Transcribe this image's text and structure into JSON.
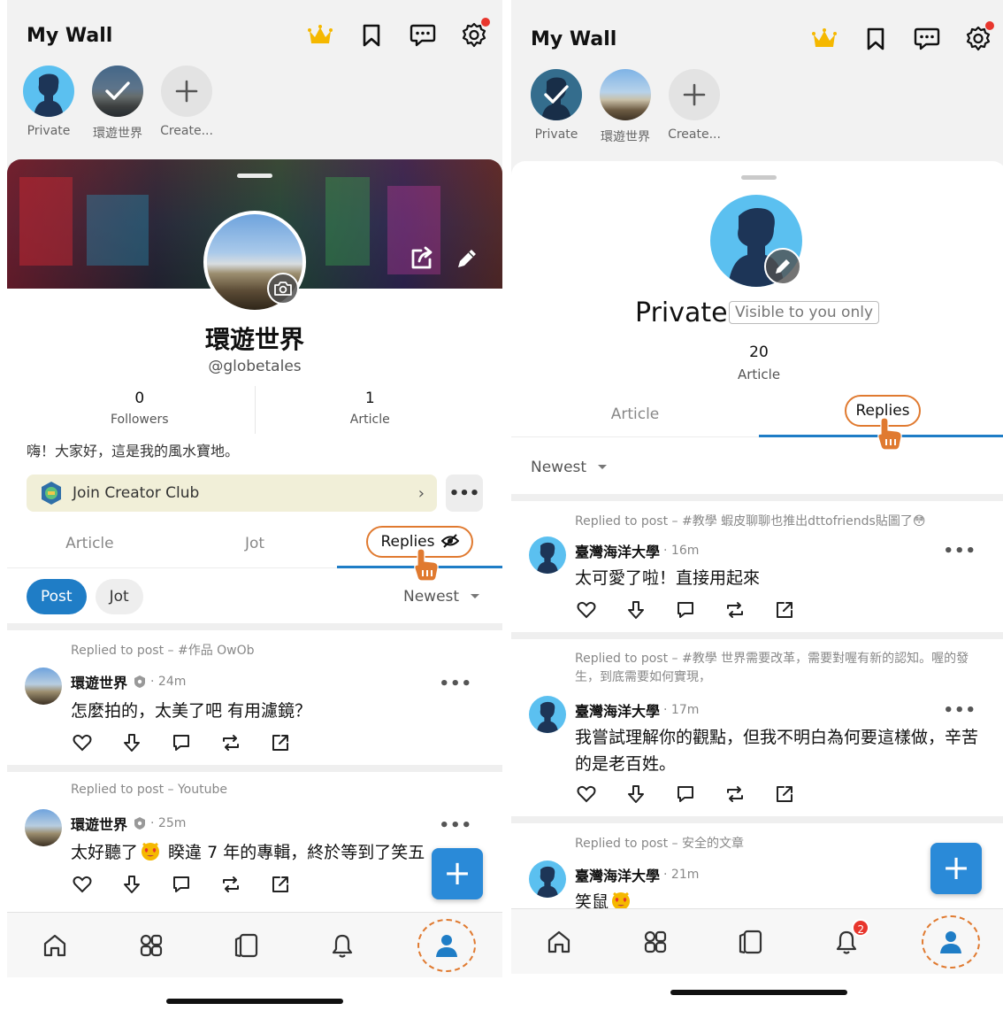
{
  "left": {
    "header": {
      "title": "My Wall"
    },
    "walls": [
      {
        "label": "Private"
      },
      {
        "label": "環遊世界"
      },
      {
        "label": "Create..."
      }
    ],
    "profile": {
      "name": "環遊世界",
      "handle": "@globetales",
      "stats": [
        {
          "value": "0",
          "caption": "Followers"
        },
        {
          "value": "1",
          "caption": "Article"
        }
      ],
      "bio": "嗨！大家好，這是我的風水寶地。",
      "club_label": "Join Creator Club",
      "club_chevron": "›",
      "more": "•••"
    },
    "tabs": [
      {
        "label": "Article"
      },
      {
        "label": "Jot"
      },
      {
        "label": "Replies"
      }
    ],
    "filters": [
      {
        "label": "Post"
      },
      {
        "label": "Jot"
      }
    ],
    "sort": "Newest",
    "posts": [
      {
        "context": "Replied to post – #作品 OwOb",
        "author": "環遊世界",
        "time": "· 24m",
        "body": "怎麼拍的，太美了吧 有用濾鏡？"
      },
      {
        "context": "Replied to post – Youtube",
        "author": "環遊世界",
        "time": "· 25m",
        "body_before_emoji": "太好聽了",
        "body_after_emoji": " 睽違 7 年的專輯，終於等到了笑五"
      }
    ],
    "fab": "+"
  },
  "right": {
    "header": {
      "title": "My Wall"
    },
    "walls": [
      {
        "label": "Private"
      },
      {
        "label": "環遊世界"
      },
      {
        "label": "Create..."
      }
    ],
    "profile": {
      "name": "Private",
      "visibility": "Visible to you only",
      "stat_value": "20",
      "stat_caption": "Article"
    },
    "tabs": [
      {
        "label": "Article"
      },
      {
        "label": "Replies"
      }
    ],
    "sort": "Newest",
    "posts": [
      {
        "context": "Replied to post – #教學 蝦皮聊聊也推出dttofriends貼圖了😳",
        "author": "臺灣海洋大學",
        "time": "· 16m",
        "body": "太可愛了啦！直接用起來"
      },
      {
        "context": "Replied to post – #教學 世界需要改革，需要對喔有新的認知。喔的發生，到底需要如何實現，",
        "author": "臺灣海洋大學",
        "time": "· 17m",
        "body": "我嘗試理解你的觀點，但我不明白為何要這樣做，辛苦的是老百姓。"
      },
      {
        "context": "Replied to post – 安全的文章",
        "author": "臺灣海洋大學",
        "time": "· 21m",
        "body": "笑鼠"
      }
    ],
    "notification_count": "2",
    "fab": "+"
  },
  "colors": {
    "accent": "#1f7dc6",
    "highlight": "#e07a30",
    "badge": "#e8362d",
    "club_bg": "#f1efd8"
  },
  "icons": [
    "crown-icon",
    "bookmark-icon",
    "chat-icon",
    "gear-icon",
    "check-icon",
    "plus-icon",
    "camera-icon",
    "share-icon",
    "pencil-icon",
    "hidden-eye-icon",
    "verified-icon",
    "heart-icon",
    "downvote-icon",
    "comment-icon",
    "repost-icon",
    "external-share-icon",
    "home-icon",
    "grid-icon",
    "cards-icon",
    "bell-icon",
    "person-icon",
    "pointing-hand-icon",
    "caret-down-icon",
    "heart-eyes-emoji-icon"
  ]
}
